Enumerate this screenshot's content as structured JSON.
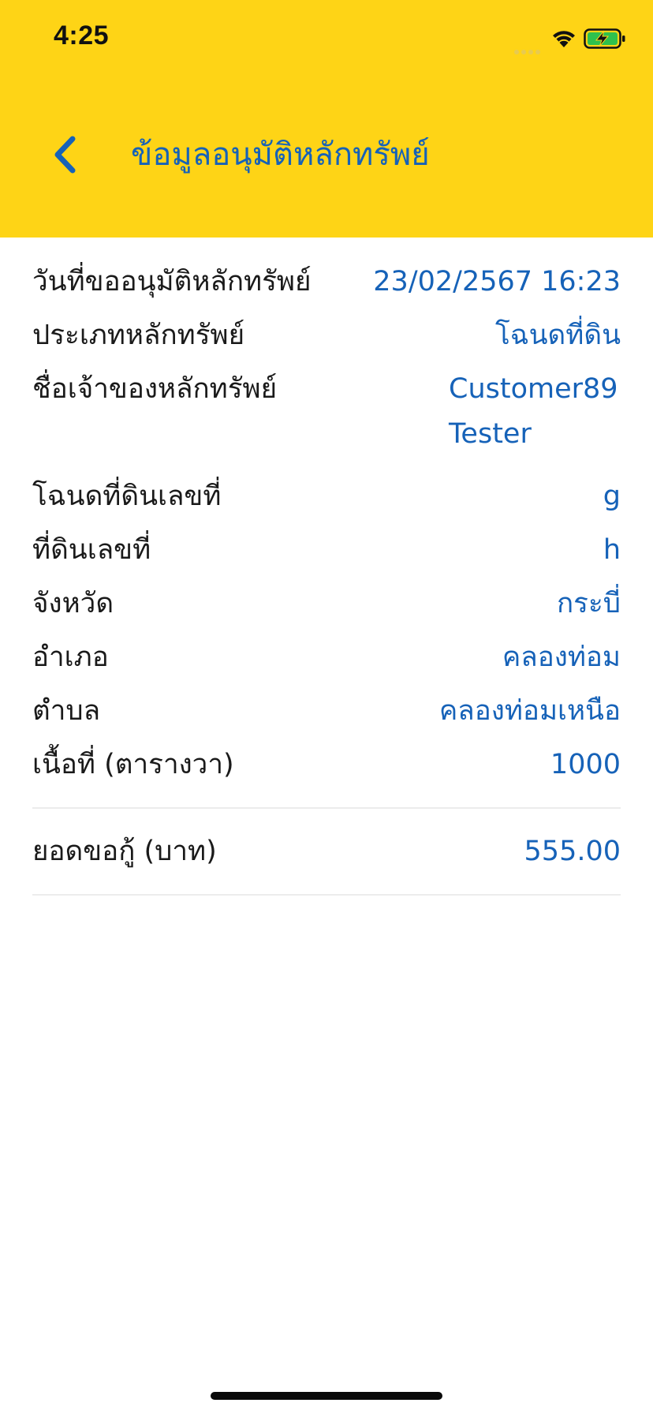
{
  "status_bar": {
    "time": "4:25"
  },
  "nav": {
    "back_icon": "chevron-left-icon",
    "title": "ข้อมูลอนุมัติหลักทรัพย์"
  },
  "details": {
    "rows": [
      {
        "label": "วันที่ขออนุมัติหลักทรัพย์",
        "value": "23/02/2567 16:23"
      },
      {
        "label": "ประเภทหลักทรัพย์",
        "value": "โฉนดที่ดิน"
      },
      {
        "label": "ชื่อเจ้าของหลักทรัพย์",
        "value_lines": [
          "Customer89",
          "Tester"
        ]
      },
      {
        "label": "โฉนดที่ดินเลขที่",
        "value": "g"
      },
      {
        "label": "ที่ดินเลขที่",
        "value": "h"
      },
      {
        "label": "จังหวัด",
        "value": "กระบี่"
      },
      {
        "label": "อำเภอ",
        "value": "คลองท่อม"
      },
      {
        "label": "ตำบล",
        "value": "คลองท่อมเหนือ"
      },
      {
        "label": "เนื้อที่ (ตารางวา)",
        "value": "1000"
      }
    ]
  },
  "loan": {
    "label": "ยอดขอกู้ (บาท)",
    "value": "555.00"
  },
  "colors": {
    "header_bg": "#FED416",
    "accent": "#1662B8",
    "label_text": "#1a1a1a",
    "divider": "#ececec"
  }
}
